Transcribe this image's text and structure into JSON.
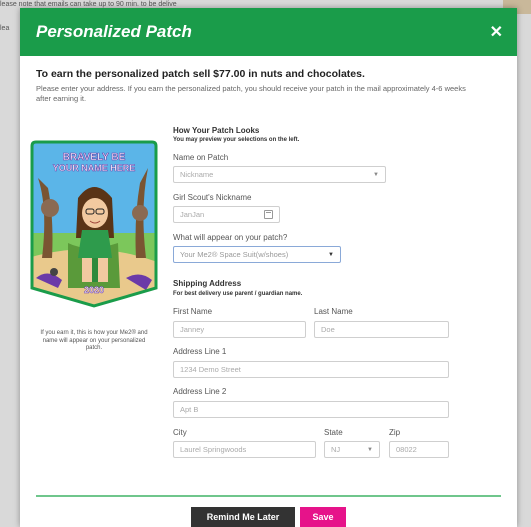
{
  "background": {
    "line1": "lease note that emails can take up to 90 min. to be delive",
    "line2": "lea"
  },
  "modal": {
    "title": "Personalized Patch",
    "close_glyph": "✕"
  },
  "intro": {
    "headline": "To earn the personalized patch sell $77.00 in nuts and chocolates.",
    "body": "Please enter your address. If you earn the personalized patch, you should receive your patch in the mail approximately 4-6 weeks after earning it."
  },
  "patch_preview": {
    "top_line1": "BRAVELY BE",
    "top_line2": "YOUR NAME HERE",
    "year": "2020",
    "caption": "If you earn it, this is how your Me2® and name will appear on your personalized patch."
  },
  "patch_section": {
    "title": "How Your Patch Looks",
    "subtitle": "You may preview your selections on the left.",
    "name_on_patch": {
      "label": "Name on Patch",
      "value": "Nickname"
    },
    "nickname": {
      "label": "Girl Scout's Nickname",
      "value": "JanJan"
    },
    "appearance": {
      "label": "What will appear on your patch?",
      "value": "Your Me2® Space Suit(w/shoes)"
    }
  },
  "shipping": {
    "title": "Shipping Address",
    "subtitle": "For best delivery use parent / guardian name.",
    "first_name": {
      "label": "First Name",
      "value": "Janney"
    },
    "last_name": {
      "label": "Last Name",
      "value": "Doe"
    },
    "address1": {
      "label": "Address Line 1",
      "value": "1234 Demo Street"
    },
    "address2": {
      "label": "Address Line 2",
      "value": "Apt B"
    },
    "city": {
      "label": "City",
      "value": "Laurel Springwoods"
    },
    "state": {
      "label": "State",
      "value": "NJ"
    },
    "zip": {
      "label": "Zip",
      "value": "08022"
    }
  },
  "actions": {
    "remind_label": "Remind Me Later",
    "save_label": "Save"
  },
  "colors": {
    "header": "#1a9c4a",
    "save": "#e6138a",
    "remind": "#333333",
    "divider": "#6fc68c"
  },
  "icons": {
    "close": "close-icon",
    "dropdown": "chevron-down-icon",
    "calendar": "calendar-icon"
  }
}
